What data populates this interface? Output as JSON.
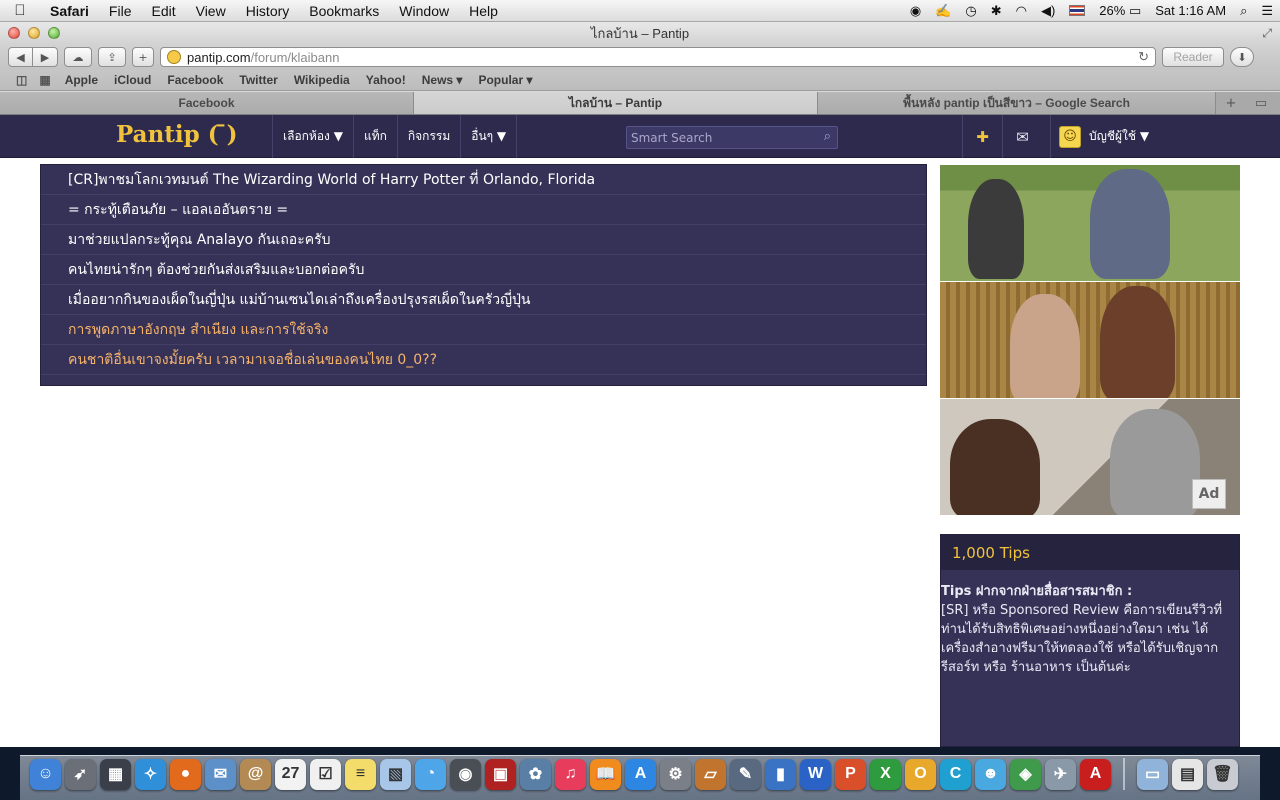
{
  "menubar": {
    "apple_icon": "apple-icon",
    "app_name": "Safari",
    "menus": [
      "File",
      "Edit",
      "View",
      "History",
      "Bookmarks",
      "Window",
      "Help"
    ],
    "battery": "26%",
    "clock": "Sat 1:16 AM"
  },
  "window": {
    "title": "ไกลบ้าน – Pantip"
  },
  "toolbar": {
    "url_host": "pantip.com",
    "url_path": "/forum/klaibann",
    "reader_label": "Reader"
  },
  "bookmarks": [
    "Apple",
    "iCloud",
    "Facebook",
    "Twitter",
    "Wikipedia",
    "Yahoo!",
    "News ▾",
    "Popular ▾"
  ],
  "tabs": [
    {
      "label": "Facebook",
      "active": false
    },
    {
      "label": "ไกลบ้าน – Pantip",
      "active": true
    },
    {
      "label": "พื้นหลัง pantip เป็นสีขาว – Google Search",
      "active": false
    }
  ],
  "pantip": {
    "logo": "Pantip ( ̄)",
    "nav": [
      "เลือกห้อง ▼",
      "แท็ก",
      "กิจกรรม",
      "อื่นๆ ▼"
    ],
    "search_placeholder": "Smart Search",
    "account_label": "บัญชีผู้ใช้ ▼",
    "topics": [
      {
        "title": "[CR]พาชมโลกเวทมนต์ The Wizarding World of Harry Potter ที่ Orlando, Florida",
        "highlight": false
      },
      {
        "title": "= กระทู้เตือนภัย – แอลเออันตราย =",
        "highlight": false
      },
      {
        "title": "มาช่วยแปลกระทู้คุณ Analayo กันเถอะครับ",
        "highlight": false
      },
      {
        "title": "คนไทยน่ารักๆ ต้องช่วยกันส่งเสริมและบอกต่อครับ",
        "highlight": false
      },
      {
        "title": "เมื่ออยากกินของเผ็ดในญี่ปุ่น แม่บ้านเซนไดเล่าถึงเครื่องปรุงรสเผ็ดในครัวญี่ปุ่น",
        "highlight": false
      },
      {
        "title": "การพูดภาษาอังกฤษ สำเนียง และการใช้จริง",
        "highlight": true
      },
      {
        "title": "คนชาติอื่นเขาจงมั้ยครับ เวลามาเจอชื่อเล่นของคนไทย 0_0??",
        "highlight": true
      }
    ],
    "ad_logo": "Ad",
    "tips": {
      "heading": "1,000 Tips",
      "title": "Tips ฝากจากฝ่ายสื่อสารสมาชิก :",
      "body": "[SR] หรือ Sponsored Review คือการเขียนรีวิวที่ท่านได้รับสิทธิพิเศษอย่างหนึ่งอย่างใดมา เช่น ได้เครื่องสำอางฟรีมาให้ทดลองใช้ หรือได้รับเชิญจากรีสอร์ท หรือ ร้านอาหาร เป็นต้นค่ะ"
    }
  },
  "colors": {
    "header_bg": "#2d2a4e",
    "panel_bg": "#363257",
    "logo": "#f1c33d",
    "topic_highlight": "#f7b36a"
  },
  "dock_icons": [
    {
      "name": "finder-icon",
      "color": "#3f82d8",
      "glyph": "☺"
    },
    {
      "name": "launchpad-icon",
      "color": "#6b6f78",
      "glyph": "➶"
    },
    {
      "name": "mission-control-icon",
      "color": "#3a3f49",
      "glyph": "▦"
    },
    {
      "name": "safari-icon",
      "color": "#2f8fd8",
      "glyph": "✧"
    },
    {
      "name": "firefox-icon",
      "color": "#e16a1c",
      "glyph": "●"
    },
    {
      "name": "mail-icon",
      "color": "#5d8fc9",
      "glyph": "✉"
    },
    {
      "name": "contacts-icon",
      "color": "#b48a54",
      "glyph": "@"
    },
    {
      "name": "calendar-icon",
      "color": "#f2f2f2",
      "glyph": "27"
    },
    {
      "name": "reminders-icon",
      "color": "#f0f0f0",
      "glyph": "☑"
    },
    {
      "name": "notes-icon",
      "color": "#f3dc6a",
      "glyph": "≡"
    },
    {
      "name": "preview-icon",
      "color": "#a8c6e8",
      "glyph": "▧"
    },
    {
      "name": "messages-icon",
      "color": "#4ea5e8",
      "glyph": "◔"
    },
    {
      "name": "facetime-icon",
      "color": "#4a4f56",
      "glyph": "◉"
    },
    {
      "name": "photo-booth-icon",
      "color": "#b02222",
      "glyph": "▣"
    },
    {
      "name": "iphoto-icon",
      "color": "#5a7fa6",
      "glyph": "✿"
    },
    {
      "name": "itunes-icon",
      "color": "#e83c5c",
      "glyph": "♫"
    },
    {
      "name": "ibooks-icon",
      "color": "#f08c1e",
      "glyph": "📖"
    },
    {
      "name": "app-store-icon",
      "color": "#2d86e2",
      "glyph": "A"
    },
    {
      "name": "system-preferences-icon",
      "color": "#7b8088",
      "glyph": "⚙"
    },
    {
      "name": "keynote-icon",
      "color": "#c0742e",
      "glyph": "▱"
    },
    {
      "name": "script-editor-icon",
      "color": "#596a80",
      "glyph": "✎"
    },
    {
      "name": "chart-app-icon",
      "color": "#3a72c4",
      "glyph": "▮"
    },
    {
      "name": "word-icon",
      "color": "#2b62c6",
      "glyph": "W"
    },
    {
      "name": "powerpoint-icon",
      "color": "#d94f2a",
      "glyph": "P"
    },
    {
      "name": "excel-icon",
      "color": "#2e9b3e",
      "glyph": "X"
    },
    {
      "name": "outlook-icon",
      "color": "#e8a82c",
      "glyph": "O"
    },
    {
      "name": "communicator-icon",
      "color": "#1fa0d0",
      "glyph": "C"
    },
    {
      "name": "messenger-icon",
      "color": "#4aa8e0",
      "glyph": "☻"
    },
    {
      "name": "ftp-client-icon",
      "color": "#3f9a4b",
      "glyph": "◈"
    },
    {
      "name": "satellite-icon",
      "color": "#8a99a8",
      "glyph": "✈"
    },
    {
      "name": "acrobat-icon",
      "color": "#c81e1e",
      "glyph": "A"
    },
    {
      "name": "separator",
      "color": "",
      "glyph": ""
    },
    {
      "name": "documents-folder-icon",
      "color": "#8fb3d9",
      "glyph": "▭"
    },
    {
      "name": "downloads-stack-icon",
      "color": "#e6e6e6",
      "glyph": "▤"
    },
    {
      "name": "trash-icon",
      "color": "#c8ccd2",
      "glyph": "🗑"
    }
  ]
}
